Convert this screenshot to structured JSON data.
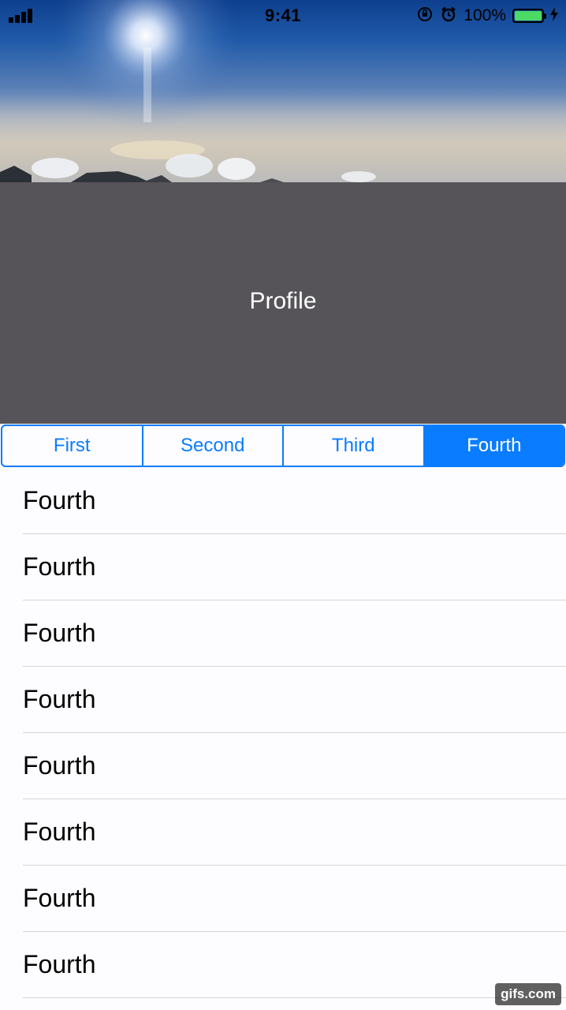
{
  "status_bar": {
    "time": "9:41",
    "battery_percent": "100%",
    "icons": [
      "signal-icon",
      "orientation-lock-icon",
      "alarm-icon",
      "battery-icon",
      "charging-icon"
    ],
    "battery_color": "#4cd964"
  },
  "header": {
    "title": "Profile",
    "background_color": "#565459"
  },
  "segmented_control": {
    "accent_color": "#0a7cff",
    "selected_index": 3,
    "segments": [
      {
        "label": "First"
      },
      {
        "label": "Second"
      },
      {
        "label": "Third"
      },
      {
        "label": "Fourth"
      }
    ]
  },
  "list": {
    "items": [
      {
        "label": "Fourth"
      },
      {
        "label": "Fourth"
      },
      {
        "label": "Fourth"
      },
      {
        "label": "Fourth"
      },
      {
        "label": "Fourth"
      },
      {
        "label": "Fourth"
      },
      {
        "label": "Fourth"
      },
      {
        "label": "Fourth"
      }
    ]
  },
  "watermark": "gifs.com"
}
